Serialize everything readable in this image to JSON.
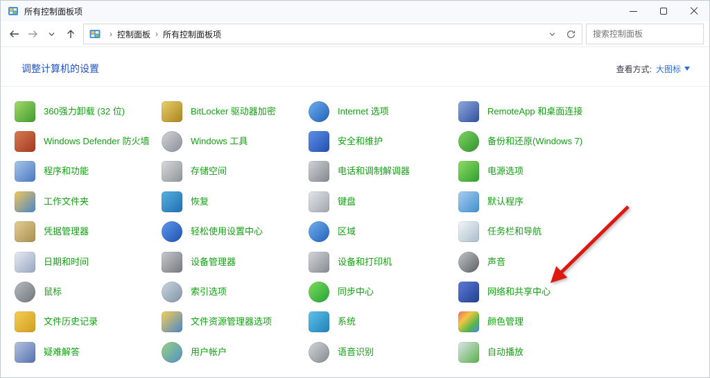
{
  "window": {
    "title": "所有控制面板项"
  },
  "toolbar": {
    "breadcrumbs": [
      "控制面板",
      "所有控制面板项"
    ],
    "search_placeholder": "搜索控制面板"
  },
  "header": {
    "title": "调整计算机的设置",
    "view_by_label": "查看方式:",
    "view_by_value": "大图标"
  },
  "items": [
    {
      "label": "360强力卸载 (32 位)",
      "icon": "uninstall-360-icon"
    },
    {
      "label": "BitLocker 驱动器加密",
      "icon": "bitlocker-icon"
    },
    {
      "label": "Internet 选项",
      "icon": "internet-options-icon"
    },
    {
      "label": "RemoteApp 和桌面连接",
      "icon": "remoteapp-icon"
    },
    {
      "label": "Windows Defender 防火墙",
      "icon": "firewall-icon"
    },
    {
      "label": "Windows 工具",
      "icon": "windows-tools-icon"
    },
    {
      "label": "安全和维护",
      "icon": "security-maintenance-icon"
    },
    {
      "label": "备份和还原(Windows 7)",
      "icon": "backup-restore-icon"
    },
    {
      "label": "程序和功能",
      "icon": "programs-features-icon"
    },
    {
      "label": "存储空间",
      "icon": "storage-spaces-icon"
    },
    {
      "label": "电话和调制解调器",
      "icon": "phone-modem-icon"
    },
    {
      "label": "电源选项",
      "icon": "power-options-icon"
    },
    {
      "label": "工作文件夹",
      "icon": "work-folders-icon"
    },
    {
      "label": "恢复",
      "icon": "recovery-icon"
    },
    {
      "label": "键盘",
      "icon": "keyboard-icon"
    },
    {
      "label": "默认程序",
      "icon": "default-programs-icon"
    },
    {
      "label": "凭据管理器",
      "icon": "credential-manager-icon"
    },
    {
      "label": "轻松使用设置中心",
      "icon": "ease-of-access-icon"
    },
    {
      "label": "区域",
      "icon": "region-icon"
    },
    {
      "label": "任务栏和导航",
      "icon": "taskbar-icon"
    },
    {
      "label": "日期和时间",
      "icon": "date-time-icon"
    },
    {
      "label": "设备管理器",
      "icon": "device-manager-icon"
    },
    {
      "label": "设备和打印机",
      "icon": "devices-printers-icon"
    },
    {
      "label": "声音",
      "icon": "sound-icon"
    },
    {
      "label": "鼠标",
      "icon": "mouse-icon"
    },
    {
      "label": "索引选项",
      "icon": "indexing-options-icon"
    },
    {
      "label": "同步中心",
      "icon": "sync-center-icon"
    },
    {
      "label": "网络和共享中心",
      "icon": "network-sharing-icon"
    },
    {
      "label": "文件历史记录",
      "icon": "file-history-icon"
    },
    {
      "label": "文件资源管理器选项",
      "icon": "file-explorer-options-icon"
    },
    {
      "label": "系统",
      "icon": "system-icon"
    },
    {
      "label": "颜色管理",
      "icon": "color-management-icon"
    },
    {
      "label": "疑难解答",
      "icon": "troubleshooting-icon"
    },
    {
      "label": "用户帐户",
      "icon": "user-accounts-icon"
    },
    {
      "label": "语音识别",
      "icon": "speech-recognition-icon"
    },
    {
      "label": "自动播放",
      "icon": "autoplay-icon"
    }
  ],
  "annotation": {
    "type": "red-arrow",
    "points_to": "网络和共享中心"
  },
  "colors": {
    "item_text": "#14a014",
    "header_blue": "#2553c0",
    "link_blue": "#2a6cd5",
    "arrow_red": "#dd1a12"
  }
}
